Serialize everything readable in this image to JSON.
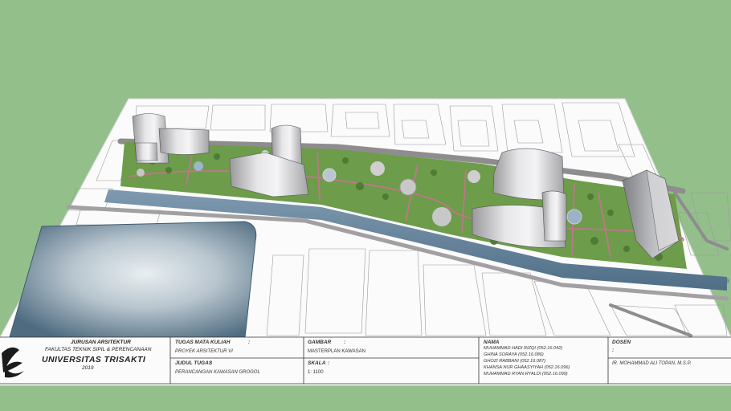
{
  "title_block": {
    "institution": {
      "department": "JURUSAN ARSITEKTUR",
      "faculty": "FAKULTAS TEKNIK SIPIL & PERENCANAAN",
      "university": "UNIVERSITAS TRISAKTI",
      "year": "2019"
    },
    "course": {
      "label": "TUGAS MATA KULIAH",
      "sep": ":",
      "value": "PROYEK ARSITEKTUR VI"
    },
    "assignment": {
      "label": "JUDUL TUGAS",
      "sep": ":",
      "value": "PERANCANGAN KAWASAN GROGOL"
    },
    "drawing": {
      "label": "GAMBAR",
      "sep": ":",
      "value": "MASTERPLAN KAWASAN"
    },
    "scale": {
      "label": "SKALA",
      "sep": ":",
      "value": "1: 1100"
    },
    "names": {
      "label": "NAMA",
      "members": [
        "MUHAMMAD HADI RIZQI (052.16.042)",
        "GHINA SORAYA (052.16.086)",
        "GHOZI RABBANI (052.16.087)",
        "KHANSA NUR GHAASYIYAH (052.16.096)",
        "MUHAMMAD RYAN RYALDI (052.16.099)"
      ]
    },
    "lecturer": {
      "label": "DOSEN",
      "sep": ":",
      "value": "IR. MOHAMMAD ALI TOPAN, M.S.P."
    }
  },
  "colors": {
    "background": "#93c08a",
    "sheet": "#fbfbfb",
    "park": "#6d9c4a",
    "river": "#5f7f96",
    "road": "#8f8c8f",
    "building": "#c9c9cb"
  }
}
